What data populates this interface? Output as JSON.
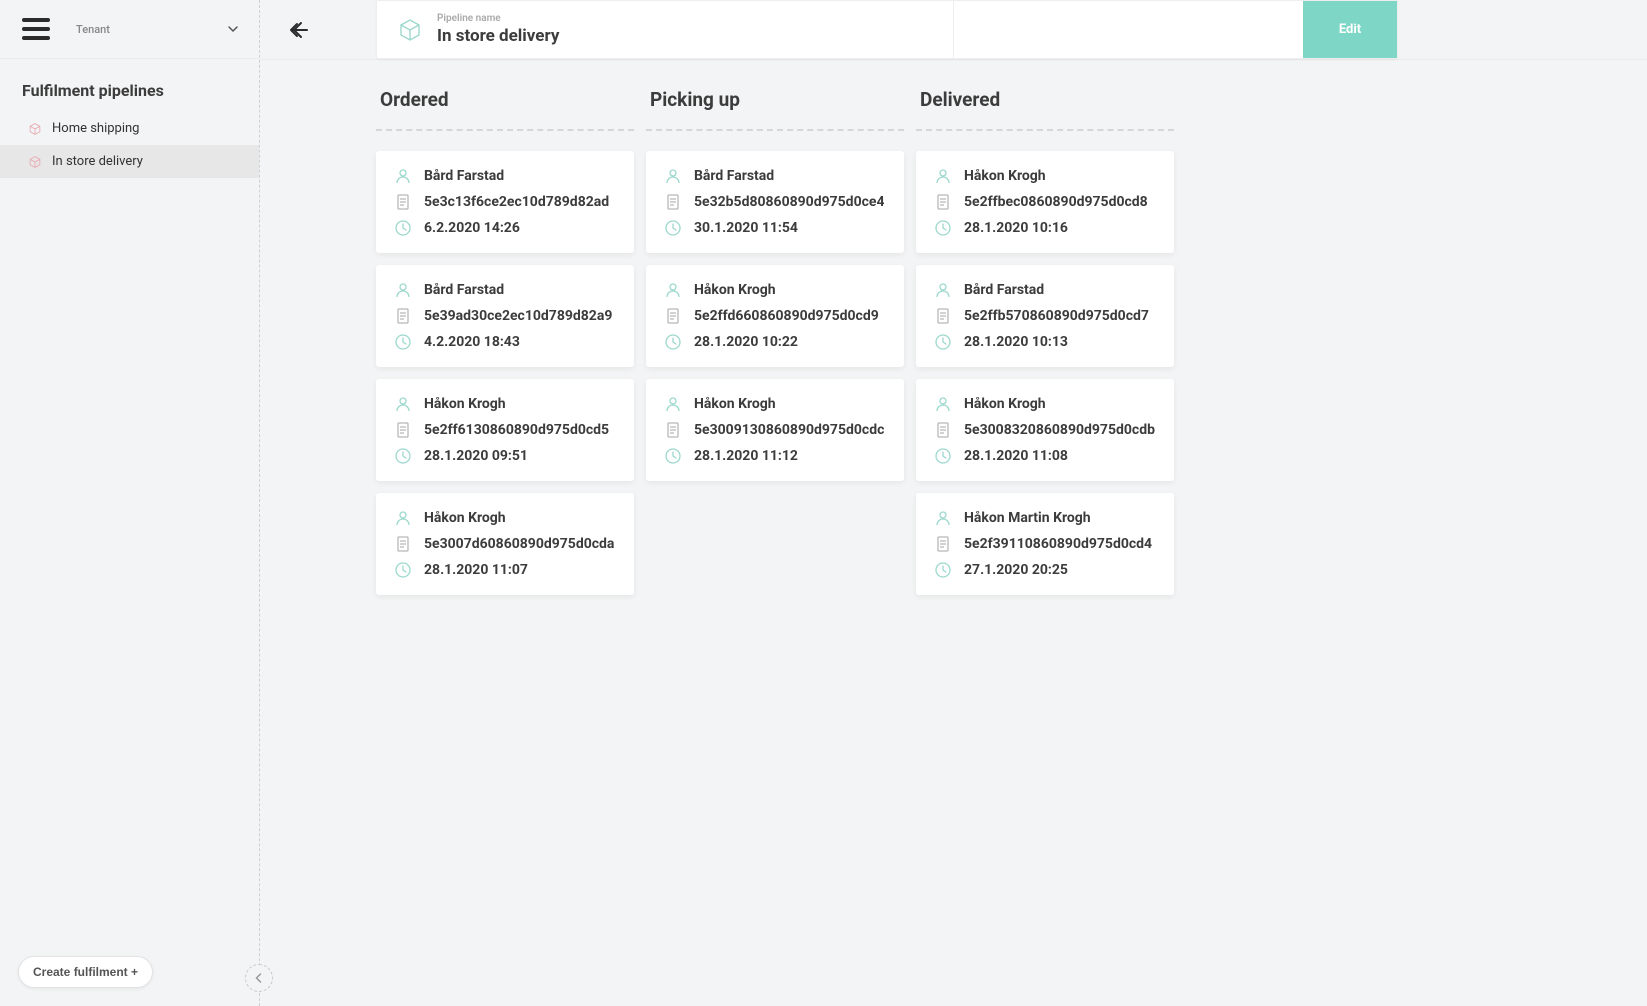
{
  "sidebar": {
    "tenant_label": "Tenant",
    "title": "Fulfilment pipelines",
    "items": [
      {
        "label": "Home shipping",
        "active": false
      },
      {
        "label": "In store delivery",
        "active": true
      }
    ],
    "create_label": "Create fulfilment +"
  },
  "header": {
    "pipeline_label": "Pipeline name",
    "pipeline_value": "In store delivery",
    "edit_label": "Edit"
  },
  "columns": [
    {
      "title": "Ordered",
      "cards": [
        {
          "name": "Bård Farstad",
          "id": "5e3c13f6ce2ec10d789d82ad",
          "time": "6.2.2020 14:26"
        },
        {
          "name": "Bård Farstad",
          "id": "5e39ad30ce2ec10d789d82a9",
          "time": "4.2.2020 18:43"
        },
        {
          "name": "Håkon Krogh",
          "id": "5e2ff6130860890d975d0cd5",
          "time": "28.1.2020 09:51"
        },
        {
          "name": "Håkon Krogh",
          "id": "5e3007d60860890d975d0cda",
          "time": "28.1.2020 11:07"
        }
      ]
    },
    {
      "title": "Picking up",
      "cards": [
        {
          "name": "Bård Farstad",
          "id": "5e32b5d80860890d975d0ce4",
          "time": "30.1.2020 11:54"
        },
        {
          "name": "Håkon Krogh",
          "id": "5e2ffd660860890d975d0cd9",
          "time": "28.1.2020 10:22"
        },
        {
          "name": "Håkon Krogh",
          "id": "5e3009130860890d975d0cdc",
          "time": "28.1.2020 11:12"
        }
      ]
    },
    {
      "title": "Delivered",
      "cards": [
        {
          "name": "Håkon Krogh",
          "id": "5e2ffbec0860890d975d0cd8",
          "time": "28.1.2020 10:16"
        },
        {
          "name": "Bård Farstad",
          "id": "5e2ffb570860890d975d0cd7",
          "time": "28.1.2020 10:13"
        },
        {
          "name": "Håkon Krogh",
          "id": "5e3008320860890d975d0cdb",
          "time": "28.1.2020 11:08"
        },
        {
          "name": "Håkon Martin Krogh",
          "id": "5e2f39110860890d975d0cd4",
          "time": "27.1.2020 20:25"
        }
      ]
    }
  ],
  "colors": {
    "accent_teal": "#7ed6c6",
    "icon_pink": "#e8a8b0",
    "icon_teal": "#9cd8cd",
    "icon_grey": "#b8b8b8"
  }
}
